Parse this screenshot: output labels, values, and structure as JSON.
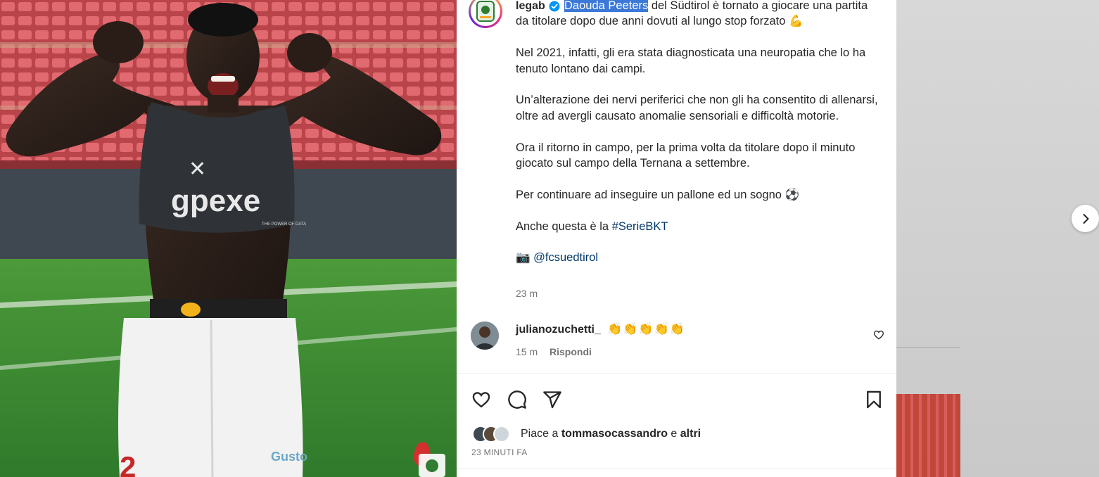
{
  "post": {
    "username": "legab",
    "caption_highlight": "Daouda Peeters",
    "caption_line1_rest": " del Südtirol è tornato a giocare una partita da titolare dopo due anni dovuti al lungo stop forzato 💪",
    "paragraph2": "Nel 2021, infatti, gli era stata diagnosticata una neuropatia che lo ha tenuto lontano dai campi.",
    "paragraph3": "Un’alterazione dei nervi periferici che non gli ha consentito di allenarsi, oltre ad avergli causato anomalie sensoriali e difficoltà motorie.",
    "paragraph4": "Ora il ritorno in campo, per la prima volta da titolare dopo il minuto giocato sul campo della Ternana a settembre.",
    "paragraph5": "Per continuare ad inseguire un pallone ed un sogno ⚽",
    "paragraph6_prefix": "Anche questa è la ",
    "hashtag": "#SerieBKT",
    "photo_credit_emoji": "📷",
    "photo_credit_handle": "@fcsuedtirol",
    "time_ago": "23 m"
  },
  "media": {
    "shirt_brand": "gpexe",
    "shirt_small_text": "THE POWER OF DATA",
    "shorts_sponsor": "Gusto"
  },
  "comment": {
    "username": "julianozuchetti_",
    "text": "👏👏👏👏👏",
    "time": "15 m",
    "reply_label": "Rispondi"
  },
  "likes": {
    "prefix": "Piace a ",
    "user": "tommasocassandro",
    "connector": " e ",
    "others": "altri"
  },
  "date": "23 MINUTI FA",
  "icons": {
    "like": "heart-icon",
    "comment": "comment-icon",
    "share": "send-icon",
    "save": "bookmark-icon",
    "next": "chevron-right-icon",
    "verified": "verified-badge-icon"
  },
  "colors": {
    "highlight": "#3b78d8",
    "link": "#00376b",
    "verified": "#0095f6",
    "muted": "#737373"
  }
}
